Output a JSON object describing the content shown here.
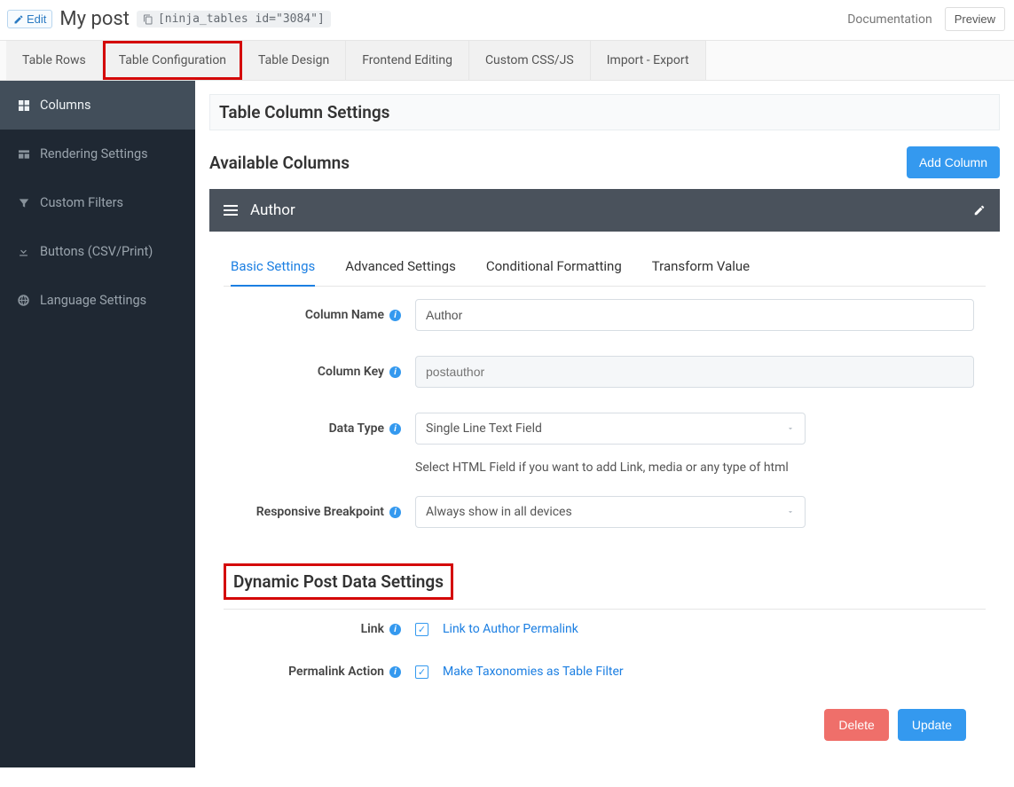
{
  "header": {
    "edit_label": "Edit",
    "post_title": "My post",
    "shortcode": "[ninja_tables id=\"3084\"]",
    "doc_link": "Documentation",
    "preview_btn": "Preview"
  },
  "top_tabs": [
    "Table Rows",
    "Table Configuration",
    "Table Design",
    "Frontend Editing",
    "Custom CSS/JS",
    "Import - Export"
  ],
  "sidebar": {
    "items": [
      {
        "label": "Columns"
      },
      {
        "label": "Rendering Settings"
      },
      {
        "label": "Custom Filters"
      },
      {
        "label": "Buttons (CSV/Print)"
      },
      {
        "label": "Language Settings"
      }
    ]
  },
  "main": {
    "heading": "Table Column Settings",
    "available_title": "Available Columns",
    "add_column_btn": "Add Column",
    "column_header": "Author",
    "inner_tabs": [
      "Basic Settings",
      "Advanced Settings",
      "Conditional Formatting",
      "Transform Value"
    ],
    "labels": {
      "column_name": "Column Name",
      "column_key": "Column Key",
      "data_type": "Data Type",
      "data_type_hint": "Select HTML Field if you want to add Link, media or any type of html",
      "responsive": "Responsive Breakpoint",
      "link": "Link",
      "permalink_action": "Permalink Action"
    },
    "values": {
      "column_name": "Author",
      "column_key_placeholder": "postauthor",
      "data_type": "Single Line Text Field",
      "responsive": "Always show in all devices",
      "link_text": "Link to Author Permalink",
      "permalink_action_text": "Make Taxonomies as Table Filter"
    },
    "section_sub": "Dynamic Post Data Settings",
    "buttons": {
      "delete": "Delete",
      "update": "Update"
    }
  }
}
